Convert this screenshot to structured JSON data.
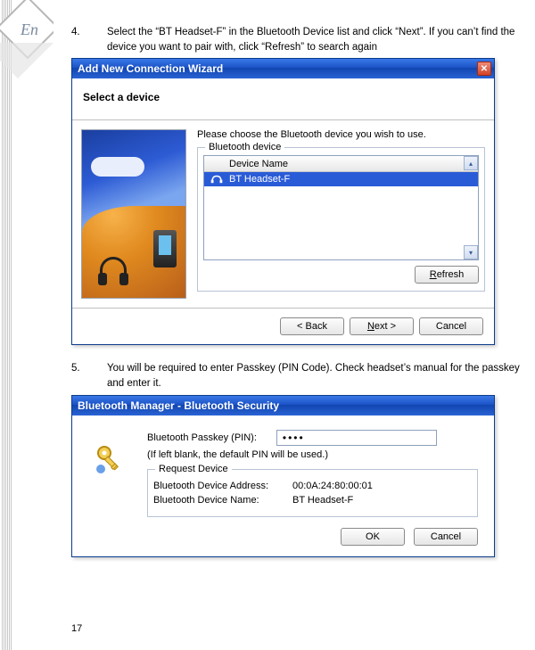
{
  "language_badge": "En",
  "page_number": "17",
  "steps": {
    "s4": {
      "num": "4.",
      "text": "Select the “BT Headset-F” in the Bluetooth Device list and click “Next”. If you can’t find the device you want to pair with, click “Refresh” to search again"
    },
    "s5": {
      "num": "5.",
      "text": "You will be required to enter Passkey (PIN Code). Check headset’s manual for the passkey and enter it."
    }
  },
  "wizard": {
    "title": "Add New Connection Wizard",
    "heading": "Select a device",
    "prompt": "Please choose the Bluetooth device you wish to use.",
    "group_label": "Bluetooth device",
    "column_header": "Device Name",
    "selected_device": "BT Headset-F",
    "buttons": {
      "refresh": "Refresh",
      "back": "< Back",
      "next": "Next >",
      "cancel": "Cancel"
    }
  },
  "bt_security": {
    "title": "Bluetooth Manager - Bluetooth Security",
    "passkey_label": "Bluetooth Passkey (PIN):",
    "passkey_value": "••••",
    "hint": "(If left blank, the default PIN will be used.)",
    "group_label": "Request Device",
    "addr_label": "Bluetooth Device Address:",
    "addr_value": "00:0A:24:80:00:01",
    "name_label": "Bluetooth Device Name:",
    "name_value": "BT Headset-F",
    "buttons": {
      "ok": "OK",
      "cancel": "Cancel"
    }
  }
}
